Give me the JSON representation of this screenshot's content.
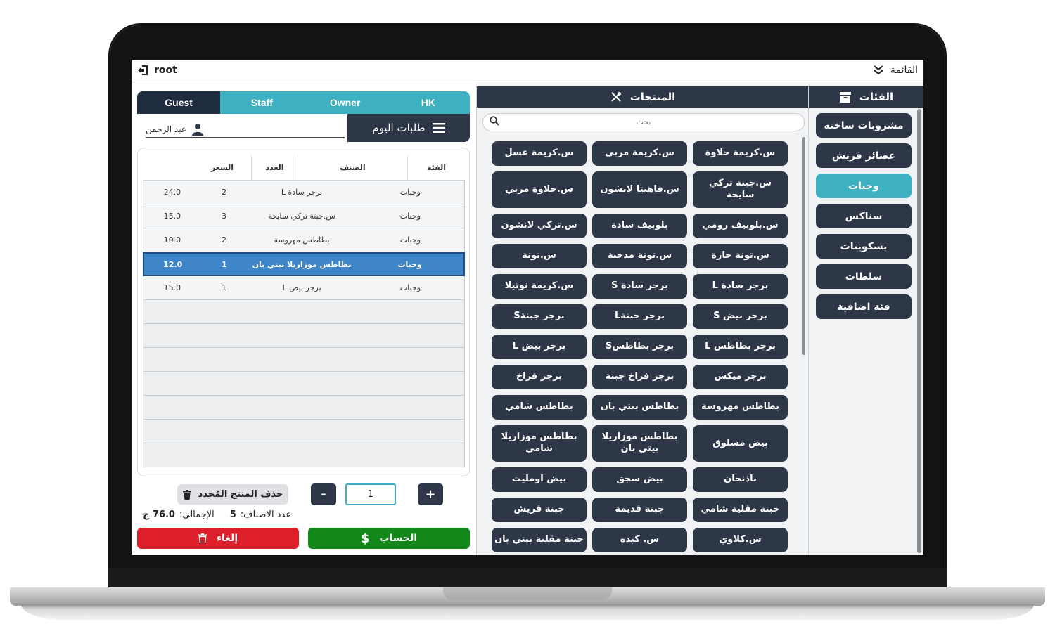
{
  "topbar": {
    "user": "root",
    "menu": "القائمة"
  },
  "tabs": [
    "Guest",
    "Staff",
    "Owner",
    "HK"
  ],
  "orders": {
    "today_label": "طلبات اليوم",
    "customer": "عبد الرحمن"
  },
  "table": {
    "headers": {
      "category": "الفئة",
      "item": "الصنف",
      "qty": "العدد",
      "price": "السعر"
    },
    "rows": [
      {
        "category": "وجبات",
        "item": "برجر سادة L",
        "qty": "2",
        "price": "24.0"
      },
      {
        "category": "وجبات",
        "item": "س.جبنة تركي سايحة",
        "qty": "3",
        "price": "15.0"
      },
      {
        "category": "وجبات",
        "item": "بطاطس مهروسة",
        "qty": "2",
        "price": "10.0"
      },
      {
        "category": "وجبات",
        "item": "بطاطس موزاريلا بيتي بان",
        "qty": "1",
        "price": "12.0"
      },
      {
        "category": "وجبات",
        "item": "برجر بيض L",
        "qty": "1",
        "price": "15.0"
      }
    ]
  },
  "controls": {
    "delete_label": "حذف المنتج المُحدد",
    "qty_value": "1",
    "minus": "-",
    "plus": "+"
  },
  "summary": {
    "count_label": "عدد الاصناف:",
    "count": "5",
    "total_label": "الإجمالي:",
    "total": "76.0 ج"
  },
  "buttons": {
    "cancel": "إلغاء",
    "pay": "الحساب"
  },
  "products": {
    "title": "المنتجات",
    "search_placeholder": "بحث",
    "items": [
      "س.كريمة حلاوة",
      "س.كريمة مربي",
      "س.كريمة عسل",
      "س.جبنة تركي سايحة",
      "س.فاهيتا لانشون",
      "س.حلاوة مربي",
      "س.بلوبيف رومي",
      "بلوبيف سادة",
      "س.تركي لانشون",
      "س.تونة حارة",
      "س.تونة مدخنة",
      "س.تونة",
      "برجر سادة L",
      "برجر سادة S",
      "س.كريمة نوتيلا",
      "برجر بيض S",
      "برجر جبنةL",
      "برجر جبنةS",
      "برجر بطاطس L",
      "برجر بطاطسS",
      "برجر بيض L",
      "برجر ميكس",
      "برجر فراخ جبنة",
      "برجر فراخ",
      "بطاطس مهروسة",
      "بطاطس بيتي بان",
      "بطاطس شامي",
      "بيض مسلوق",
      "بطاطس موزاريلا بيتي بان",
      "بطاطس موزاريلا شامي",
      "باذنجان",
      "بيض سجق",
      "بيض اومليت",
      "جبنة مقلية شامي",
      "جبنة قديمة",
      "جبنة قريش",
      "س.كلاوي",
      "س. كبده",
      "جبنة مقلية بيتي بان"
    ]
  },
  "categories": {
    "title": "الفئات",
    "items": [
      "مشروبات ساخنه",
      "عصائر فريش",
      "وجبات",
      "سناكس",
      "بسكويتات",
      "سلطات",
      "فئة اضافية"
    ],
    "active": "وجبات"
  },
  "colors": {
    "dark": "#2d3748",
    "accent": "#3db0c1",
    "danger": "#dc1f2a",
    "success": "#12881a",
    "selected_row": "#3f86c9"
  }
}
